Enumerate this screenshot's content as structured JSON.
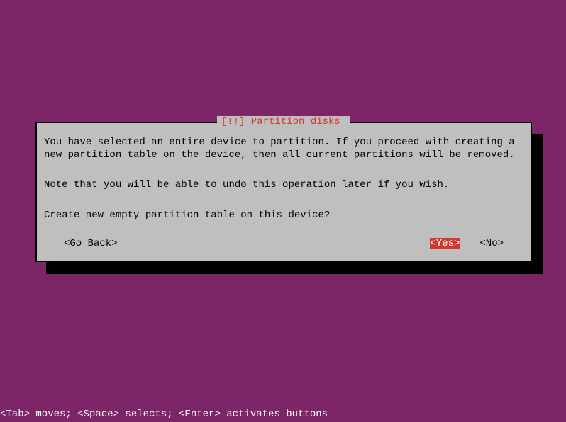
{
  "dialog": {
    "title_prefix": "[!!] ",
    "title": "Partition disks",
    "paragraph1": "You have selected an entire device to partition. If you proceed with creating a new partition table on the device, then all current partitions will be removed.",
    "paragraph2": "Note that you will be able to undo this operation later if you wish.",
    "question": "Create new empty partition table on this device?",
    "buttons": {
      "go_back": "<Go Back>",
      "yes": "<Yes>",
      "no": "<No>"
    }
  },
  "statusbar": "<Tab> moves; <Space> selects; <Enter> activates buttons"
}
